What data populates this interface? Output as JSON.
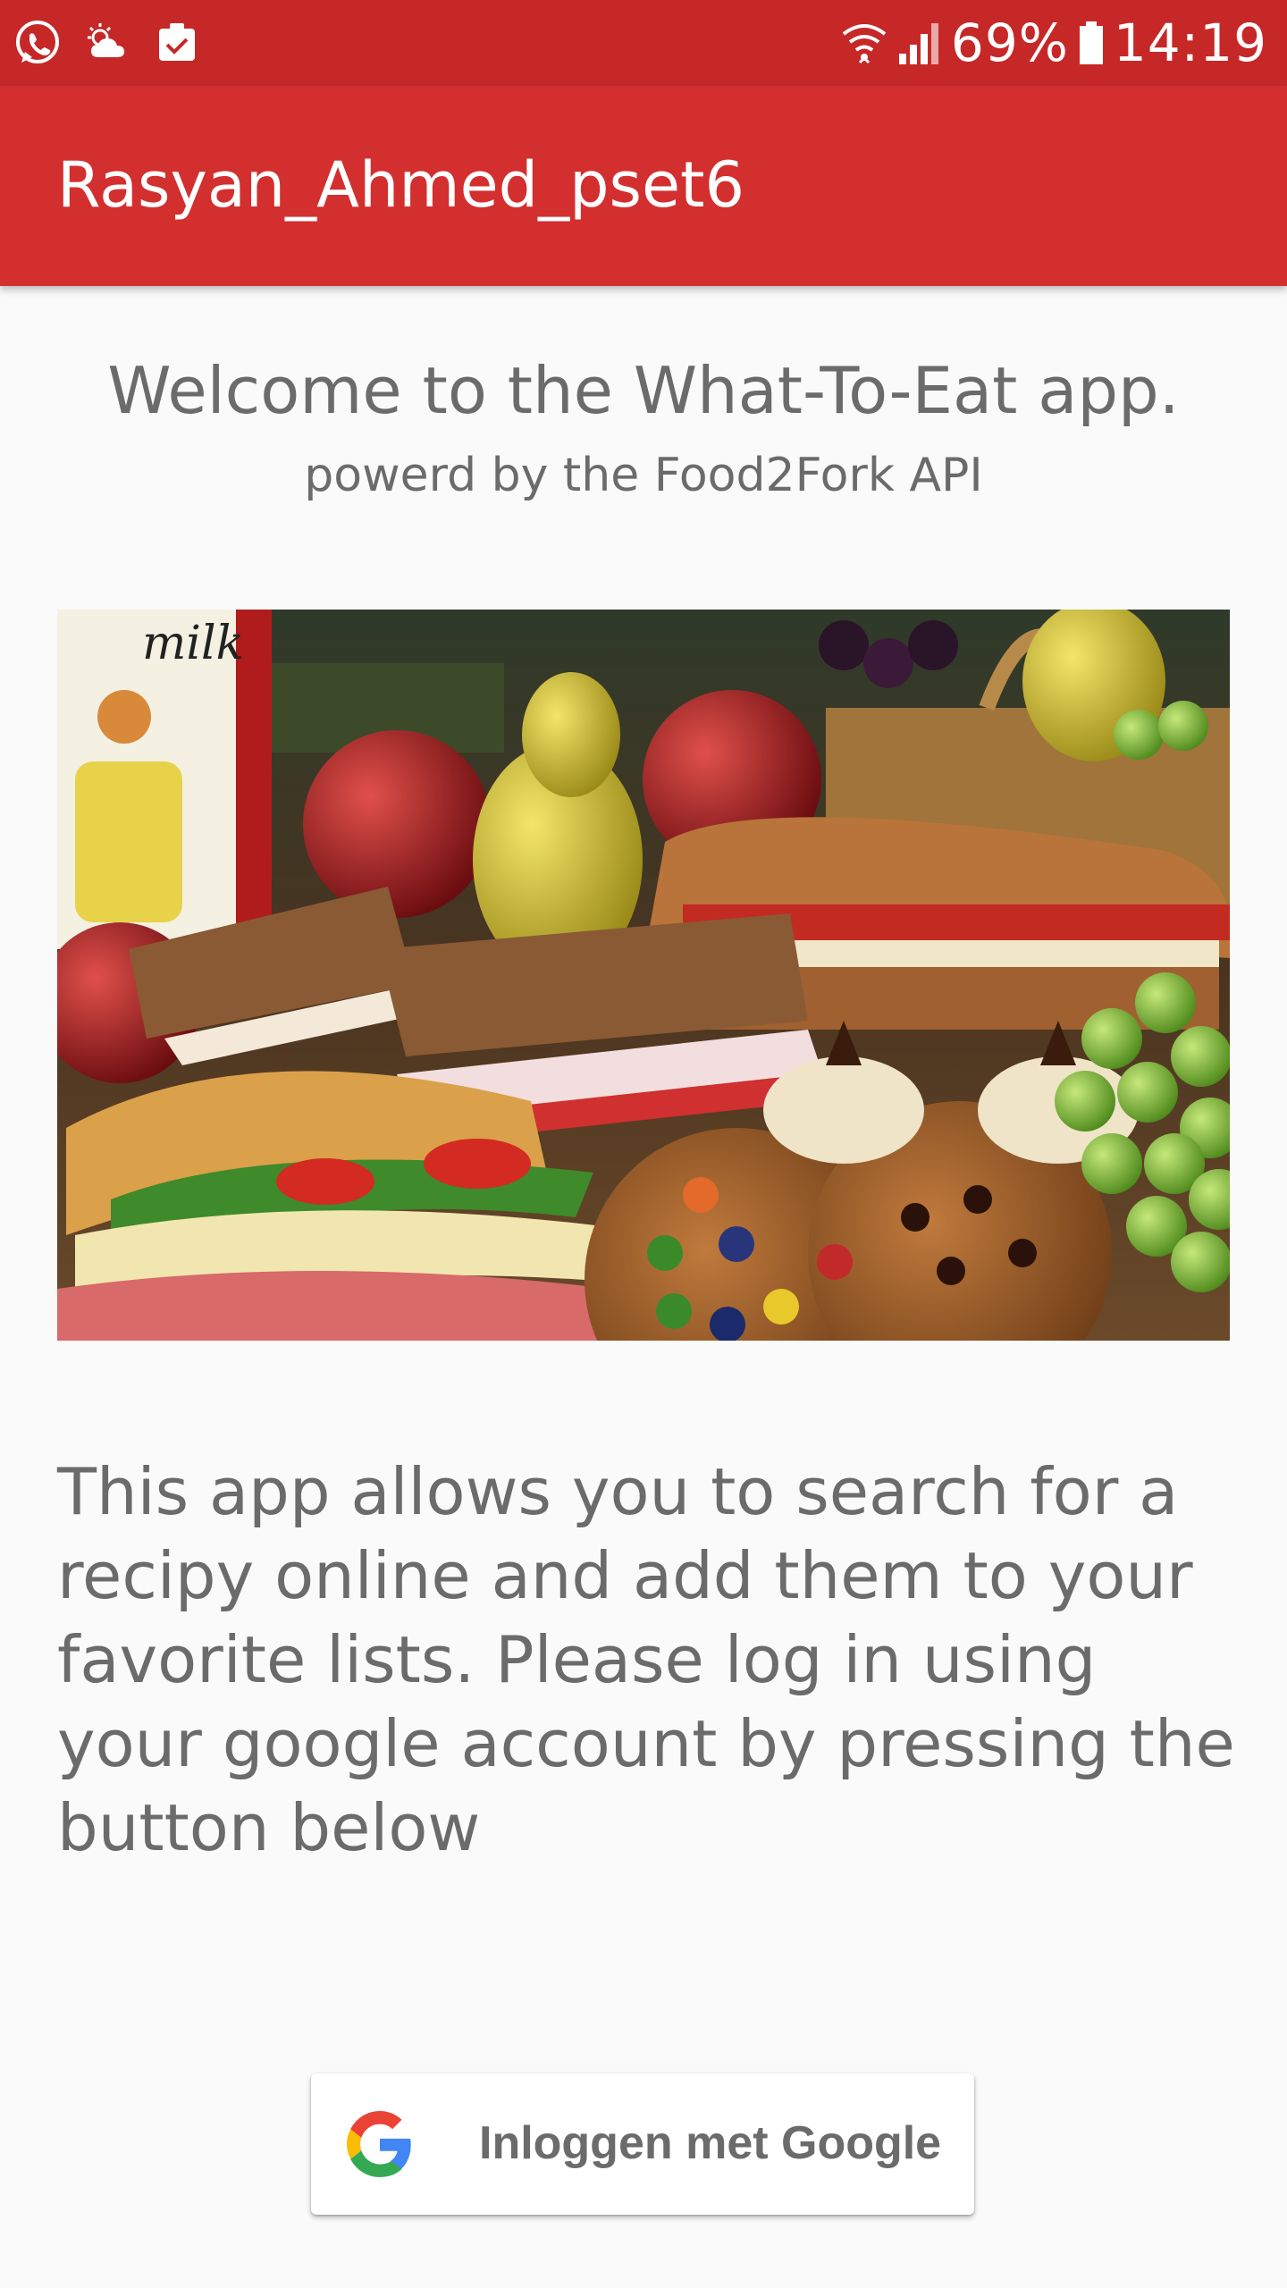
{
  "status_bar": {
    "battery_percent": "69%",
    "time": "14:19",
    "left_icons": [
      "whatsapp-icon",
      "weather-icon",
      "clipboard-icon"
    ],
    "right_icons": [
      "wifi-icon",
      "signal-icon",
      "battery-icon"
    ]
  },
  "app_bar": {
    "title": "Rasyan_Ahmed_pset6"
  },
  "main": {
    "welcome": "Welcome to the What-To-Eat app.",
    "powered_by": "powerd by the Food2Fork API",
    "description": "This app allows you to search for a recipy online and add them to your favorite lists. Please log in using your google account by pressing the button below"
  },
  "login": {
    "button_label": "Inloggen met Google",
    "icon": "google-icon"
  },
  "colors": {
    "status_bar": "#c62828",
    "app_bar": "#d32f2f",
    "text": "#6b6b6b",
    "background": "#fafafa"
  }
}
